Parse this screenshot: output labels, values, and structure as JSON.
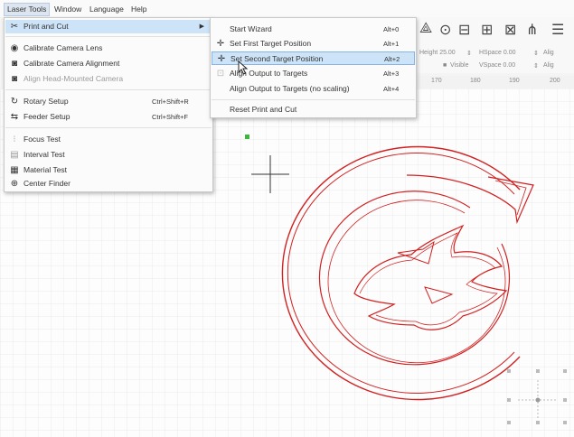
{
  "menubar": {
    "items": [
      "Laser Tools",
      "Window",
      "Language",
      "Help"
    ]
  },
  "laser_tools_menu": {
    "items": [
      {
        "label": "Print and Cut",
        "icon": "print-cut-icon",
        "has_submenu": true
      },
      {
        "label": "Calibrate Camera Lens",
        "icon": "camera-icon"
      },
      {
        "label": "Calibrate Camera Alignment",
        "icon": "camera-icon"
      },
      {
        "label": "Align Head-Mounted Camera",
        "icon": "camera-icon",
        "disabled": true
      },
      {
        "label": "Rotary Setup",
        "shortcut": "Ctrl+Shift+R",
        "icon": "rotary-icon"
      },
      {
        "label": "Feeder Setup",
        "shortcut": "Ctrl+Shift+F",
        "icon": "feeder-icon"
      },
      {
        "label": "Focus Test",
        "icon": "focus-test-icon"
      },
      {
        "label": "Interval Test",
        "icon": "interval-test-icon"
      },
      {
        "label": "Material Test",
        "icon": "grid-icon"
      },
      {
        "label": "Center Finder",
        "icon": "crosshair-icon"
      }
    ]
  },
  "print_cut_submenu": {
    "items": [
      {
        "label": "Start Wizard",
        "shortcut": "Alt+0"
      },
      {
        "label": "Set First Target Position",
        "shortcut": "Alt+1",
        "icon": "target-icon"
      },
      {
        "label": "Set Second Target Position",
        "shortcut": "Alt+2",
        "icon": "target-icon"
      },
      {
        "label": "Align Output to Targets",
        "shortcut": "Alt+3",
        "icon": "align-icon"
      },
      {
        "label": "Align Output to Targets (no scaling)",
        "shortcut": "Alt+4"
      },
      {
        "label": "Reset Print and Cut"
      }
    ]
  },
  "toolbar": {
    "height_label": "Height",
    "height_value": "25.00",
    "hspace_label": "HSpace",
    "hspace_value": "0.00",
    "vspace_label": "VSpace",
    "vspace_value": "0.00",
    "visible_label": "Visible",
    "align_label": "Alig"
  },
  "ruler": {
    "ticks": [
      "170",
      "180",
      "190",
      "200"
    ]
  },
  "colors": {
    "highlight": "#cde3f7",
    "design_stroke": "#d22020",
    "selected_node": "#3ab83a"
  }
}
